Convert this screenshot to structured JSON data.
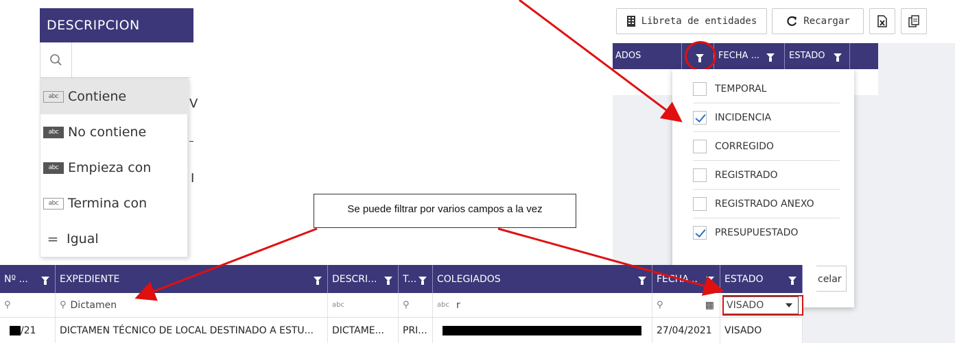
{
  "descripcion_panel": {
    "header": "DESCRIPCION",
    "search_icon": "search-icon",
    "options": [
      {
        "label": "Contiene",
        "icon_text": "abc",
        "selected": true
      },
      {
        "label": "No contiene",
        "icon_text": "abc",
        "selected": false
      },
      {
        "label": "Empieza con",
        "icon_text": "abc",
        "selected": false
      },
      {
        "label": "Termina con",
        "icon_text": "abc",
        "selected": false
      },
      {
        "label": "Igual",
        "icon_text": "=",
        "selected": false
      }
    ],
    "clipped_chars": [
      "V",
      "",
      "I"
    ]
  },
  "estado_panel": {
    "toolbar": {
      "libreta_label": "Libreta de entidades",
      "recargar_label": "Recargar"
    },
    "columns": [
      "ADOS",
      "FECHA ...",
      "ESTADO"
    ],
    "options": [
      {
        "label": "TEMPORAL",
        "checked": false
      },
      {
        "label": "INCIDENCIA",
        "checked": true
      },
      {
        "label": "CORREGIDO",
        "checked": false
      },
      {
        "label": "REGISTRADO",
        "checked": false
      },
      {
        "label": "REGISTRADO ANEXO",
        "checked": false
      },
      {
        "label": "PRESUPUESTADO",
        "checked": true
      }
    ],
    "cancel_label": "celar"
  },
  "callout": {
    "text": "Se puede filtrar por varios campos a la vez"
  },
  "grid": {
    "headers": [
      "Nº ...",
      "EXPEDIENTE",
      "DESCRI...",
      "T...",
      "COLEGIADOS",
      "FECHA...",
      "ESTADO"
    ],
    "filters": {
      "expediente": "Dictamen",
      "colegiados": "r",
      "estado": "VISADO"
    },
    "row": {
      "numero_suffix": "/21",
      "expediente": "DICTAMEN TÉCNICO DE LOCAL DESTINADO A ESTU...",
      "descripcion": "DICTAME...",
      "tipo": "PRI...",
      "fecha": "27/04/2021",
      "estado": "VISADO"
    }
  },
  "colors": {
    "header_bg": "#3c3778",
    "arrow": "#e01010",
    "check": "#2a6fc9"
  }
}
